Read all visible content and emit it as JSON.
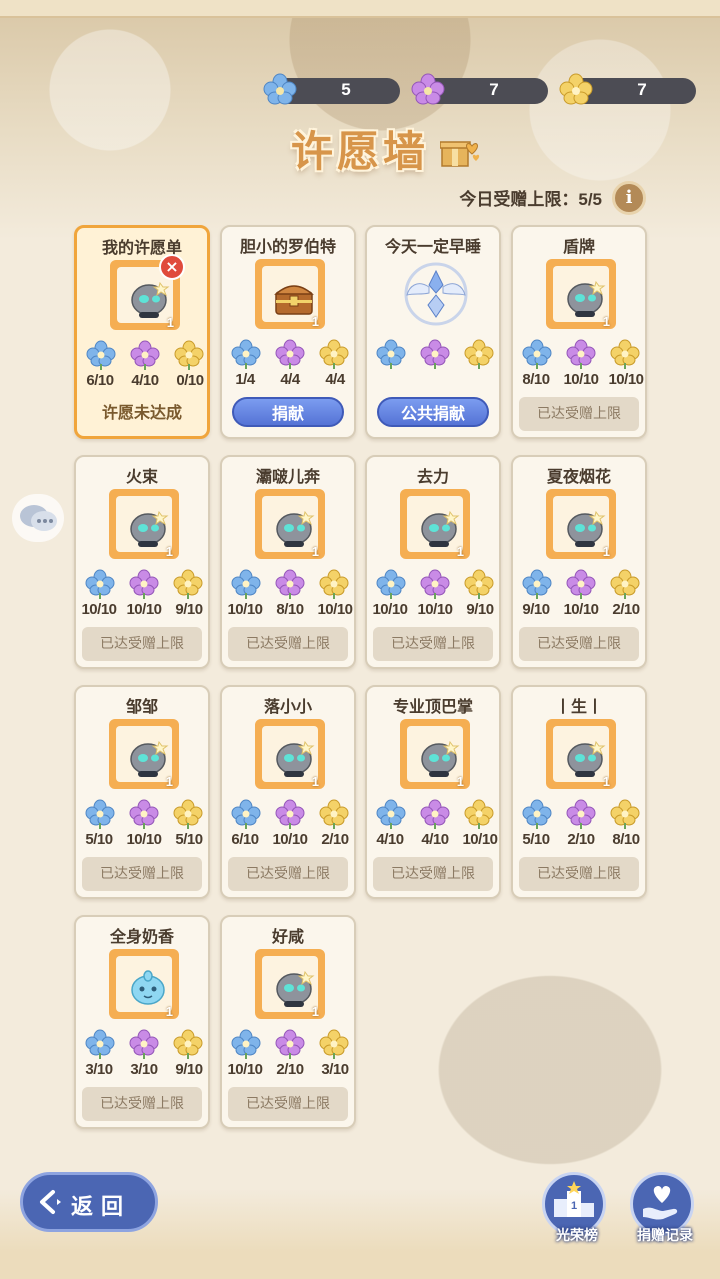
{
  "header": {
    "currencies": [
      {
        "icon": "blue-flower-icon",
        "value": "5"
      },
      {
        "icon": "purple-flower-icon",
        "value": "7"
      },
      {
        "icon": "yellow-flower-icon",
        "value": "7"
      }
    ],
    "title": "许愿墙",
    "limit_text": "今日受赠上限：5/5",
    "info_label": "i"
  },
  "colors": {
    "blue_flower": "#7fb4ea",
    "purple_flower": "#c98be6",
    "yellow_flower": "#f4d268",
    "accent_orange": "#f0a53c",
    "button_blue": "#5573d6"
  },
  "cards": [
    {
      "name": "我的许愿单",
      "item": "creature",
      "qty": "1",
      "counts": [
        "6/10",
        "4/10",
        "0/10"
      ],
      "footer": "许愿未达成",
      "footer_type": "mine"
    },
    {
      "name": "胆小的罗伯特",
      "item": "chest",
      "qty": "1",
      "counts": [
        "1/4",
        "4/4",
        "4/4"
      ],
      "footer": "捐献",
      "footer_type": "button"
    },
    {
      "name": "今天一定早睡",
      "item": "emblem",
      "qty": "",
      "counts": [
        "",
        "",
        ""
      ],
      "footer": "公共捐献",
      "footer_type": "button"
    },
    {
      "name": "盾牌",
      "item": "creature",
      "qty": "1",
      "counts": [
        "8/10",
        "10/10",
        "10/10"
      ],
      "footer": "已达受赠上限",
      "footer_type": "disabled"
    },
    {
      "name": "火束",
      "item": "creature",
      "qty": "1",
      "counts": [
        "10/10",
        "10/10",
        "9/10"
      ],
      "footer": "已达受赠上限",
      "footer_type": "disabled"
    },
    {
      "name": "灞啵儿奔",
      "item": "creature",
      "qty": "1",
      "counts": [
        "10/10",
        "8/10",
        "10/10"
      ],
      "footer": "已达受赠上限",
      "footer_type": "disabled"
    },
    {
      "name": "去力",
      "item": "creature",
      "qty": "1",
      "counts": [
        "10/10",
        "10/10",
        "9/10"
      ],
      "footer": "已达受赠上限",
      "footer_type": "disabled"
    },
    {
      "name": "夏夜烟花",
      "item": "creature",
      "qty": "1",
      "counts": [
        "9/10",
        "10/10",
        "2/10"
      ],
      "footer": "已达受赠上限",
      "footer_type": "disabled"
    },
    {
      "name": "邹邹",
      "item": "creature",
      "qty": "1",
      "counts": [
        "5/10",
        "10/10",
        "5/10"
      ],
      "footer": "已达受赠上限",
      "footer_type": "disabled"
    },
    {
      "name": "落小小",
      "item": "creature",
      "qty": "1",
      "counts": [
        "6/10",
        "10/10",
        "2/10"
      ],
      "footer": "已达受赠上限",
      "footer_type": "disabled"
    },
    {
      "name": "专业顶巴掌",
      "item": "creature",
      "qty": "1",
      "counts": [
        "4/10",
        "4/10",
        "10/10"
      ],
      "footer": "已达受赠上限",
      "footer_type": "disabled"
    },
    {
      "name": "丨生丨",
      "item": "creature",
      "qty": "1",
      "counts": [
        "5/10",
        "2/10",
        "8/10"
      ],
      "footer": "已达受赠上限",
      "footer_type": "disabled"
    },
    {
      "name": "全身奶香",
      "item": "blue-creature",
      "qty": "1",
      "counts": [
        "3/10",
        "3/10",
        "9/10"
      ],
      "footer": "已达受赠上限",
      "footer_type": "disabled"
    },
    {
      "name": "好咸",
      "item": "creature",
      "qty": "1",
      "counts": [
        "10/10",
        "2/10",
        "3/10"
      ],
      "footer": "已达受赠上限",
      "footer_type": "disabled"
    }
  ],
  "bottom": {
    "back_label": "返回",
    "honor_label": "光荣榜",
    "donation_label": "捐赠记录"
  }
}
